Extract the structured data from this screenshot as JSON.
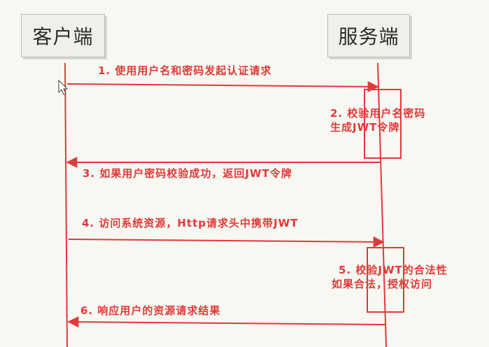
{
  "participants": {
    "client": "客户端",
    "server": "服务端"
  },
  "steps": [
    {
      "label": "1. 使用用户名和密码发起认证请求"
    },
    {
      "line1": "2. 校验用户名密码",
      "line2": "生成JWT令牌"
    },
    {
      "label": "3. 如果用户密码校验成功，返回JWT令牌"
    },
    {
      "label": "4. 访问系统资源，Http请求头中携带JWT"
    },
    {
      "line1": "5. 校验JWT的合法性",
      "line2": "如果合法，授权访问"
    },
    {
      "label": "6. 响应用户的资源请求结果"
    }
  ],
  "colors": {
    "arrow": "#e03a3a",
    "text": "#e03a3a"
  }
}
